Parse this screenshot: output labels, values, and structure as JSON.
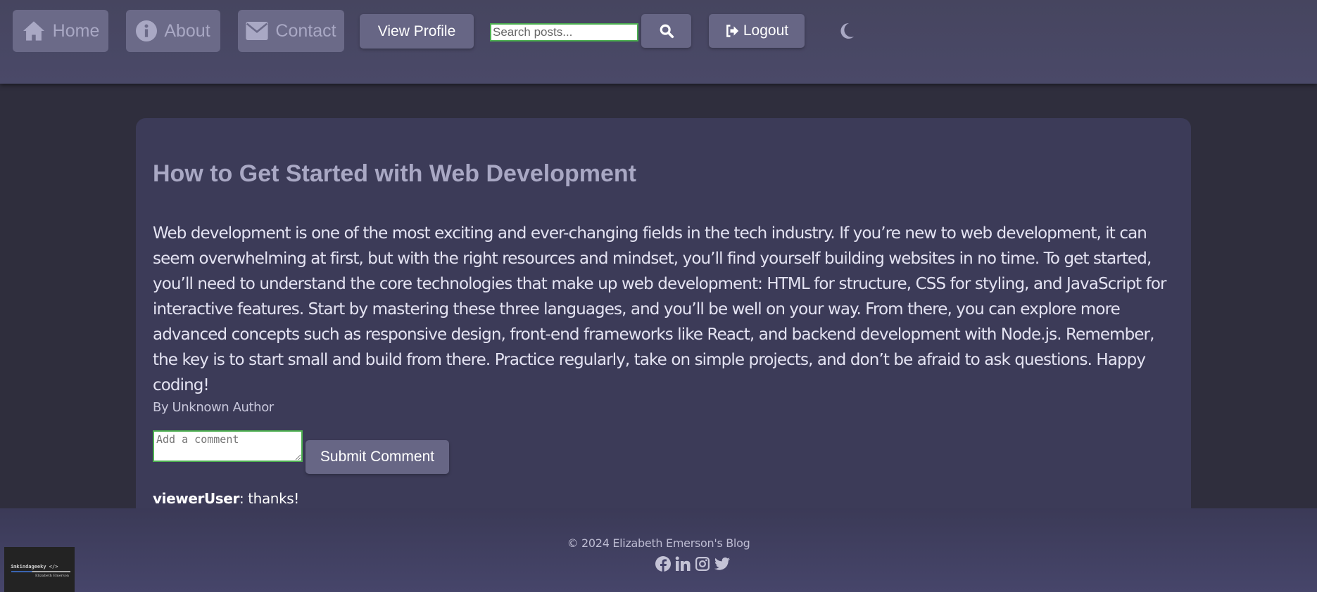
{
  "nav": {
    "home": "Home",
    "about": "About",
    "contact": "Contact",
    "view_profile": "View Profile",
    "search_placeholder": "Search posts...",
    "logout": "Logout"
  },
  "post": {
    "title": "How to Get Started with Web Development",
    "body": "Web development is one of the most exciting and ever-changing fields in the tech industry. If you’re new to web development, it can seem overwhelming at first, but with the right resources and mindset, you’ll find yourself building websites in no time. To get started, you’ll need to understand the core technologies that make up web development: HTML for structure, CSS for styling, and JavaScript for interactive features. Start by mastering these three languages, and you’ll be well on your way. From there, you can explore more advanced concepts such as responsive design, front-end frameworks like React, and backend development with Node.js. Remember, the key is to start small and build from there. Practice regularly, take on simple projects, and don’t be afraid to ask questions. Happy coding!",
    "author": "By Unknown Author",
    "comment_placeholder": "Add a comment",
    "submit": "Submit Comment",
    "comments": [
      {
        "user": "viewerUser",
        "text": ": thanks!"
      }
    ]
  },
  "footer": {
    "copyright": "© 2024 Elizabeth Emerson's Blog",
    "logo_text": "imkindageeky </>",
    "logo_sub": "Elizabeth Emerson"
  }
}
